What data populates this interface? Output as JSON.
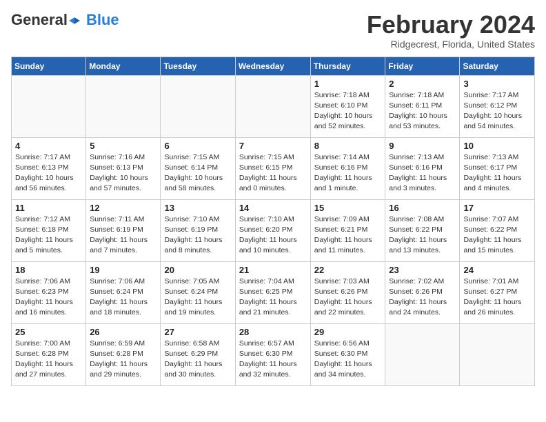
{
  "header": {
    "logo_general": "General",
    "logo_blue": "Blue",
    "month": "February 2024",
    "location": "Ridgecrest, Florida, United States"
  },
  "days_of_week": [
    "Sunday",
    "Monday",
    "Tuesday",
    "Wednesday",
    "Thursday",
    "Friday",
    "Saturday"
  ],
  "weeks": [
    [
      {
        "day": "",
        "info": ""
      },
      {
        "day": "",
        "info": ""
      },
      {
        "day": "",
        "info": ""
      },
      {
        "day": "",
        "info": ""
      },
      {
        "day": "1",
        "info": "Sunrise: 7:18 AM\nSunset: 6:10 PM\nDaylight: 10 hours\nand 52 minutes."
      },
      {
        "day": "2",
        "info": "Sunrise: 7:18 AM\nSunset: 6:11 PM\nDaylight: 10 hours\nand 53 minutes."
      },
      {
        "day": "3",
        "info": "Sunrise: 7:17 AM\nSunset: 6:12 PM\nDaylight: 10 hours\nand 54 minutes."
      }
    ],
    [
      {
        "day": "4",
        "info": "Sunrise: 7:17 AM\nSunset: 6:13 PM\nDaylight: 10 hours\nand 56 minutes."
      },
      {
        "day": "5",
        "info": "Sunrise: 7:16 AM\nSunset: 6:13 PM\nDaylight: 10 hours\nand 57 minutes."
      },
      {
        "day": "6",
        "info": "Sunrise: 7:15 AM\nSunset: 6:14 PM\nDaylight: 10 hours\nand 58 minutes."
      },
      {
        "day": "7",
        "info": "Sunrise: 7:15 AM\nSunset: 6:15 PM\nDaylight: 11 hours\nand 0 minutes."
      },
      {
        "day": "8",
        "info": "Sunrise: 7:14 AM\nSunset: 6:16 PM\nDaylight: 11 hours\nand 1 minute."
      },
      {
        "day": "9",
        "info": "Sunrise: 7:13 AM\nSunset: 6:16 PM\nDaylight: 11 hours\nand 3 minutes."
      },
      {
        "day": "10",
        "info": "Sunrise: 7:13 AM\nSunset: 6:17 PM\nDaylight: 11 hours\nand 4 minutes."
      }
    ],
    [
      {
        "day": "11",
        "info": "Sunrise: 7:12 AM\nSunset: 6:18 PM\nDaylight: 11 hours\nand 5 minutes."
      },
      {
        "day": "12",
        "info": "Sunrise: 7:11 AM\nSunset: 6:19 PM\nDaylight: 11 hours\nand 7 minutes."
      },
      {
        "day": "13",
        "info": "Sunrise: 7:10 AM\nSunset: 6:19 PM\nDaylight: 11 hours\nand 8 minutes."
      },
      {
        "day": "14",
        "info": "Sunrise: 7:10 AM\nSunset: 6:20 PM\nDaylight: 11 hours\nand 10 minutes."
      },
      {
        "day": "15",
        "info": "Sunrise: 7:09 AM\nSunset: 6:21 PM\nDaylight: 11 hours\nand 11 minutes."
      },
      {
        "day": "16",
        "info": "Sunrise: 7:08 AM\nSunset: 6:22 PM\nDaylight: 11 hours\nand 13 minutes."
      },
      {
        "day": "17",
        "info": "Sunrise: 7:07 AM\nSunset: 6:22 PM\nDaylight: 11 hours\nand 15 minutes."
      }
    ],
    [
      {
        "day": "18",
        "info": "Sunrise: 7:06 AM\nSunset: 6:23 PM\nDaylight: 11 hours\nand 16 minutes."
      },
      {
        "day": "19",
        "info": "Sunrise: 7:06 AM\nSunset: 6:24 PM\nDaylight: 11 hours\nand 18 minutes."
      },
      {
        "day": "20",
        "info": "Sunrise: 7:05 AM\nSunset: 6:24 PM\nDaylight: 11 hours\nand 19 minutes."
      },
      {
        "day": "21",
        "info": "Sunrise: 7:04 AM\nSunset: 6:25 PM\nDaylight: 11 hours\nand 21 minutes."
      },
      {
        "day": "22",
        "info": "Sunrise: 7:03 AM\nSunset: 6:26 PM\nDaylight: 11 hours\nand 22 minutes."
      },
      {
        "day": "23",
        "info": "Sunrise: 7:02 AM\nSunset: 6:26 PM\nDaylight: 11 hours\nand 24 minutes."
      },
      {
        "day": "24",
        "info": "Sunrise: 7:01 AM\nSunset: 6:27 PM\nDaylight: 11 hours\nand 26 minutes."
      }
    ],
    [
      {
        "day": "25",
        "info": "Sunrise: 7:00 AM\nSunset: 6:28 PM\nDaylight: 11 hours\nand 27 minutes."
      },
      {
        "day": "26",
        "info": "Sunrise: 6:59 AM\nSunset: 6:28 PM\nDaylight: 11 hours\nand 29 minutes."
      },
      {
        "day": "27",
        "info": "Sunrise: 6:58 AM\nSunset: 6:29 PM\nDaylight: 11 hours\nand 30 minutes."
      },
      {
        "day": "28",
        "info": "Sunrise: 6:57 AM\nSunset: 6:30 PM\nDaylight: 11 hours\nand 32 minutes."
      },
      {
        "day": "29",
        "info": "Sunrise: 6:56 AM\nSunset: 6:30 PM\nDaylight: 11 hours\nand 34 minutes."
      },
      {
        "day": "",
        "info": ""
      },
      {
        "day": "",
        "info": ""
      }
    ]
  ]
}
